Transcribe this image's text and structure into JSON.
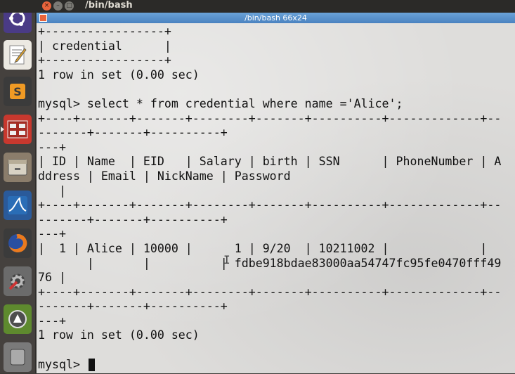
{
  "topbar": {
    "title": "/bin/bash",
    "buttons": [
      "×",
      "–",
      "□"
    ]
  },
  "launcher": {
    "items": [
      {
        "name": "ubuntu-dash-icon",
        "color": "#4a3b86"
      },
      {
        "name": "text-editor-icon",
        "color": "#ece9e2"
      },
      {
        "name": "sublime-text-icon",
        "color": "#3b3b3b"
      },
      {
        "name": "terminal-icon",
        "color": "#c8382e"
      },
      {
        "name": "files-icon",
        "color": "#8b7d6b"
      },
      {
        "name": "wireshark-icon",
        "color": "#2a5a9a"
      },
      {
        "name": "firefox-icon",
        "color": "#e8782c"
      },
      {
        "name": "settings-icon",
        "color": "#6b6b6b"
      },
      {
        "name": "software-updater-icon",
        "color": "#5e8a2e"
      },
      {
        "name": "storage-icon",
        "color": "#7a7a7a"
      }
    ]
  },
  "window": {
    "title": "/bin/bash 66x24"
  },
  "terminal": {
    "lines": [
      "+-----------------+",
      "| credential      |",
      "+-----------------+",
      "1 row in set (0.00 sec)",
      "",
      "mysql> select * from credential where name ='Alice';",
      "+----+-------+-------+--------+-------+----------+-------------+--",
      "-------+-------+----------+",
      "---+",
      "| ID | Name  | EID   | Salary | birth | SSN      | PhoneNumber | A",
      "ddress | Email | NickName | Password",
      "   |",
      "+----+-------+-------+--------+-------+----------+-------------+--",
      "-------+-------+----------+",
      "---+",
      "|  1 | Alice | 10000 |      1 | 9/20  | 10211002 |             |",
      "       |       |          | fdbe918bdae83000aa54747fc95fe0470fff49",
      "76 |",
      "+----+-------+-------+--------+-------+----------+-------------+--",
      "-------+-------+----------+",
      "---+",
      "1 row in set (0.00 sec)",
      ""
    ],
    "prompt": "mysql> "
  },
  "colors": {
    "title_bar": "#4a82c0",
    "terminal_bg": "#dedddb",
    "terminal_fg": "#111111"
  }
}
